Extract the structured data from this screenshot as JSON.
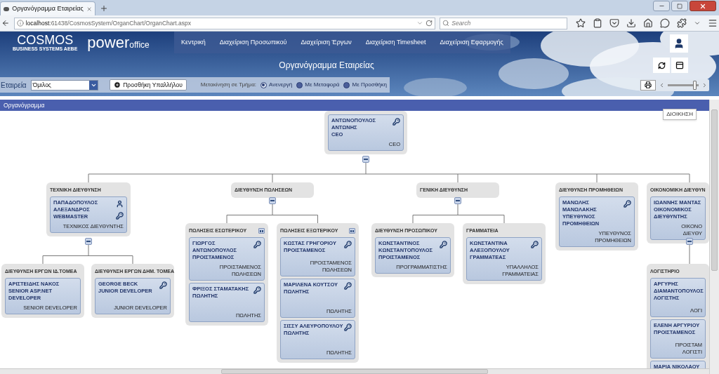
{
  "browser": {
    "tab_title": "Οργανόγραμμα Εταιρείας",
    "url_host": "localhost",
    "url_path": ":61438/CosmosSystem/OrganChart/OrganChart.aspx",
    "search_placeholder": "Search"
  },
  "header": {
    "logo": "COSMOS",
    "logo_tagline": "BUSINESS SYSTEMS AEBE",
    "brand_main": "power",
    "brand_sub": "office",
    "nav": [
      "Κεντρική",
      "Διαχείριση Προσωπικού",
      "Διαχείριση Έργων",
      "Διαχείριση Timesheet",
      "Διαχείριση Εφαρμογής"
    ],
    "page_title": "Οργανόγραμμα Εταιρείας"
  },
  "toolbar": {
    "company_label": "Εταιρεία",
    "company_value": "Όμιλος",
    "add_button": "Προσθήκη Υπαλλήλου",
    "move_label": "Μετακίνηση σε Τμήμα:",
    "move_options": [
      {
        "label": "Ανενεργή",
        "selected": true
      },
      {
        "label": "Με Μεταφορά",
        "selected": false
      },
      {
        "label": "Με Προσθήκη",
        "selected": false
      }
    ],
    "zoom": {
      "level": 0.88
    }
  },
  "panel": {
    "title": "Οργανόγραμμα",
    "tooltip": "ΔΙΟΙΚΗΣΗ"
  },
  "chart": {
    "root": {
      "people": [
        {
          "name": [
            "ΑΝΤΩΝΟΠΟΥΛΟΣ",
            "ΑΝΤΩΝΗΣ",
            "CEO"
          ],
          "role": [
            "CEO"
          ],
          "key": true
        }
      ],
      "children": [
        {
          "title": "ΤΕΧΝΙΚΗ ΔΙΕΥΘΥΝΣΗ",
          "people": [
            {
              "name": [
                "ΠΑΠΑΔΟΠΟΥΛΟΣ",
                "ΑΛΕΞΑΝΔΡΟΣ",
                "WEBMASTER"
              ],
              "role": [
                "ΤΕΧΝΙΚΟΣ ΔΙΕΥΘΥΝΤΗΣ"
              ],
              "person_badge": true,
              "key": true
            }
          ],
          "children": [
            {
              "title": "ΔΙΕΥΘΥΝΣΗ ΕΡΓΩΝ ΙΔ.ΤΟΜΕΑ",
              "people": [
                {
                  "name": [
                    "ΑΡΙΣΤΕΙΔΗΣ ΝΑΚΟΣ",
                    "SENIOR ASP.NET",
                    "DEVELOPER"
                  ],
                  "role": [
                    "SENIOR DEVELOPER"
                  ],
                  "key": false
                }
              ]
            },
            {
              "title": "ΔΙΕΥΘΥΝΣΗ ΕΡΓΩΝ ΔΗΜ. ΤΟΜΕΑ",
              "people": [
                {
                  "name": [
                    "GEORGE BECK",
                    "JUNIOR DEVELOPER"
                  ],
                  "role": [
                    "JUNIOR DEVELOPER"
                  ],
                  "key": true
                }
              ]
            }
          ]
        },
        {
          "title": "ΔΙΕΥΘΥΝΣΗ ΠΩΛΗΣΕΩΝ",
          "children": [
            {
              "title": "ΠΩΛΗΣΕΙΣ ΕΣΩΤΕΡΙΚΟΥ",
              "side_toggle": true,
              "people": [
                {
                  "name": [
                    "ΓΙΩΡΓΟΣ",
                    "ΑΝΤΩΝΟΠΟΥΛΟΣ",
                    "ΠΡΟΙΣΤΑΜΕΝΟΣ"
                  ],
                  "role": [
                    "ΠΡΟΙΣΤΑΜΕΝΟΣ",
                    "ΠΩΛΗΣΕΩΝ"
                  ],
                  "key": true
                },
                {
                  "name": [
                    "ΦΡΙΞΟΣ ΣΤΑΜΑΤΑΚΗΣ",
                    "ΠΩΛΗΤΗΣ"
                  ],
                  "role": [
                    "ΠΩΛΗΤΗΣ"
                  ],
                  "key": true
                }
              ]
            },
            {
              "title": "ΠΩΛΗΣΕΙΣ ΕΞΩΤΕΡΙΚΟΥ",
              "side_toggle": true,
              "people": [
                {
                  "name": [
                    "ΚΩΣΤΑΣ ΓΡΗΓΟΡΙΟΥ",
                    "ΠΡΟΙΣΤΑΜΕΝΟΣ"
                  ],
                  "role": [
                    "ΠΡΟΙΣΤΑΜΕΝΟΣ",
                    "ΠΩΛΗΣΕΩΝ"
                  ],
                  "key": true
                },
                {
                  "name": [
                    "ΜΑΡΙΛΕΝΑ ΚΟΥΤΣΟΥ",
                    "ΠΩΛΗΤΗΣ"
                  ],
                  "role": [
                    "ΠΩΛΗΤΗΣ"
                  ],
                  "key": true
                },
                {
                  "name": [
                    "ΣΙΣΣΥ ΑΛΕΥΡΟΠΟΥΛΟΥ",
                    "ΠΩΛΗΤΗΣ"
                  ],
                  "role": [
                    "ΠΩΛΗΤΗΣ"
                  ],
                  "key": true
                }
              ]
            }
          ]
        },
        {
          "title": "ΓΕΝΙΚΗ ΔΙΕΥΘΥΝΣΗ",
          "children": [
            {
              "title": "ΔΙΕΥΘΥΝΣΗ ΠΡΟΣΩΠΙΚΟΥ",
              "people": [
                {
                  "name": [
                    "ΚΩΝΣΤΑΝΤΙΝΟΣ",
                    "ΚΩΝΣΤΑΝΤΟΠΟΥΛΟΣ",
                    "ΠΡΟΙΣΤΑΜΕΝΟΣ"
                  ],
                  "role": [
                    "ΠΡΟΓΡΑΜΜΑΤΙΣΤΗΣ"
                  ],
                  "key": true
                }
              ]
            },
            {
              "title": "ΓΡΑΜΜΑΤΕΙΑ",
              "people": [
                {
                  "name": [
                    "ΚΩΝΣΤΑΝΤΙΝΑ",
                    "ΑΛΕΞΟΠΟΥΛΟΥ",
                    "ΓΡΑΜΜΑΤΕΑΣ"
                  ],
                  "role": [
                    "ΥΠΑΛΛΗΛΟΣ",
                    "ΓΡΑΜΜΑΤΕΙΑΣ"
                  ],
                  "key": true
                }
              ]
            }
          ]
        },
        {
          "title": "ΔΙΕΥΘΥΝΣΗ ΠΡΟΜΗΘΕΙΩΝ",
          "people": [
            {
              "name": [
                "ΜΑΝΩΛΗΣ",
                "ΜΑΝΩΛΑΚΗΣ",
                "ΥΠΕΥΘΥΝΟΣ",
                "ΠΡΟΜΗΘΕΙΩΝ"
              ],
              "role": [
                "ΥΠΕΥΘΥΝΟΣ",
                "ΠΡΟΜΗΘΕΙΩΝ"
              ],
              "key": true
            }
          ]
        },
        {
          "title": "ΟΙΚΟΝΟΜΙΚΗ ΔΙΕΥΘΥΝ",
          "people": [
            {
              "name": [
                "ΙΩΑΝΝΗΣ ΜΑΝΤΑΣ",
                "ΟΙΚΟΝΟΜΙΚΟΣ",
                "ΔΙΕΥΘΥΝΤΗΣ"
              ],
              "role": [
                "ΟΙΚΟΝΟ",
                "ΔΙΕΥΘΥ"
              ],
              "key": false
            }
          ],
          "children": [
            {
              "title": "ΛΟΓΙΣΤΗΡΙΟ",
              "people": [
                {
                  "name": [
                    "ΑΡΓΥΡΗΣ",
                    "ΔΙΑΜΑΝΤΟΠΟΥΛΟΣ",
                    "ΛΟΓΙΣΤΗΣ"
                  ],
                  "role": [
                    "ΛΟΓΙ"
                  ],
                  "key": false
                },
                {
                  "name": [
                    "ΕΛΕΝΗ ΑΡΓΥΡΙΟΥ",
                    "ΠΡΟΙΣΤΑΜΕΝΟΣ"
                  ],
                  "role": [
                    "ΠΡΟΙΣΤΑΜ",
                    "ΛΟΓΙΣΤΙ"
                  ],
                  "key": false
                },
                {
                  "name": [
                    "ΜΑΡΙΑ ΝΙΚΟΛΑΟΥ"
                  ],
                  "key": false
                }
              ]
            }
          ]
        }
      ]
    }
  }
}
